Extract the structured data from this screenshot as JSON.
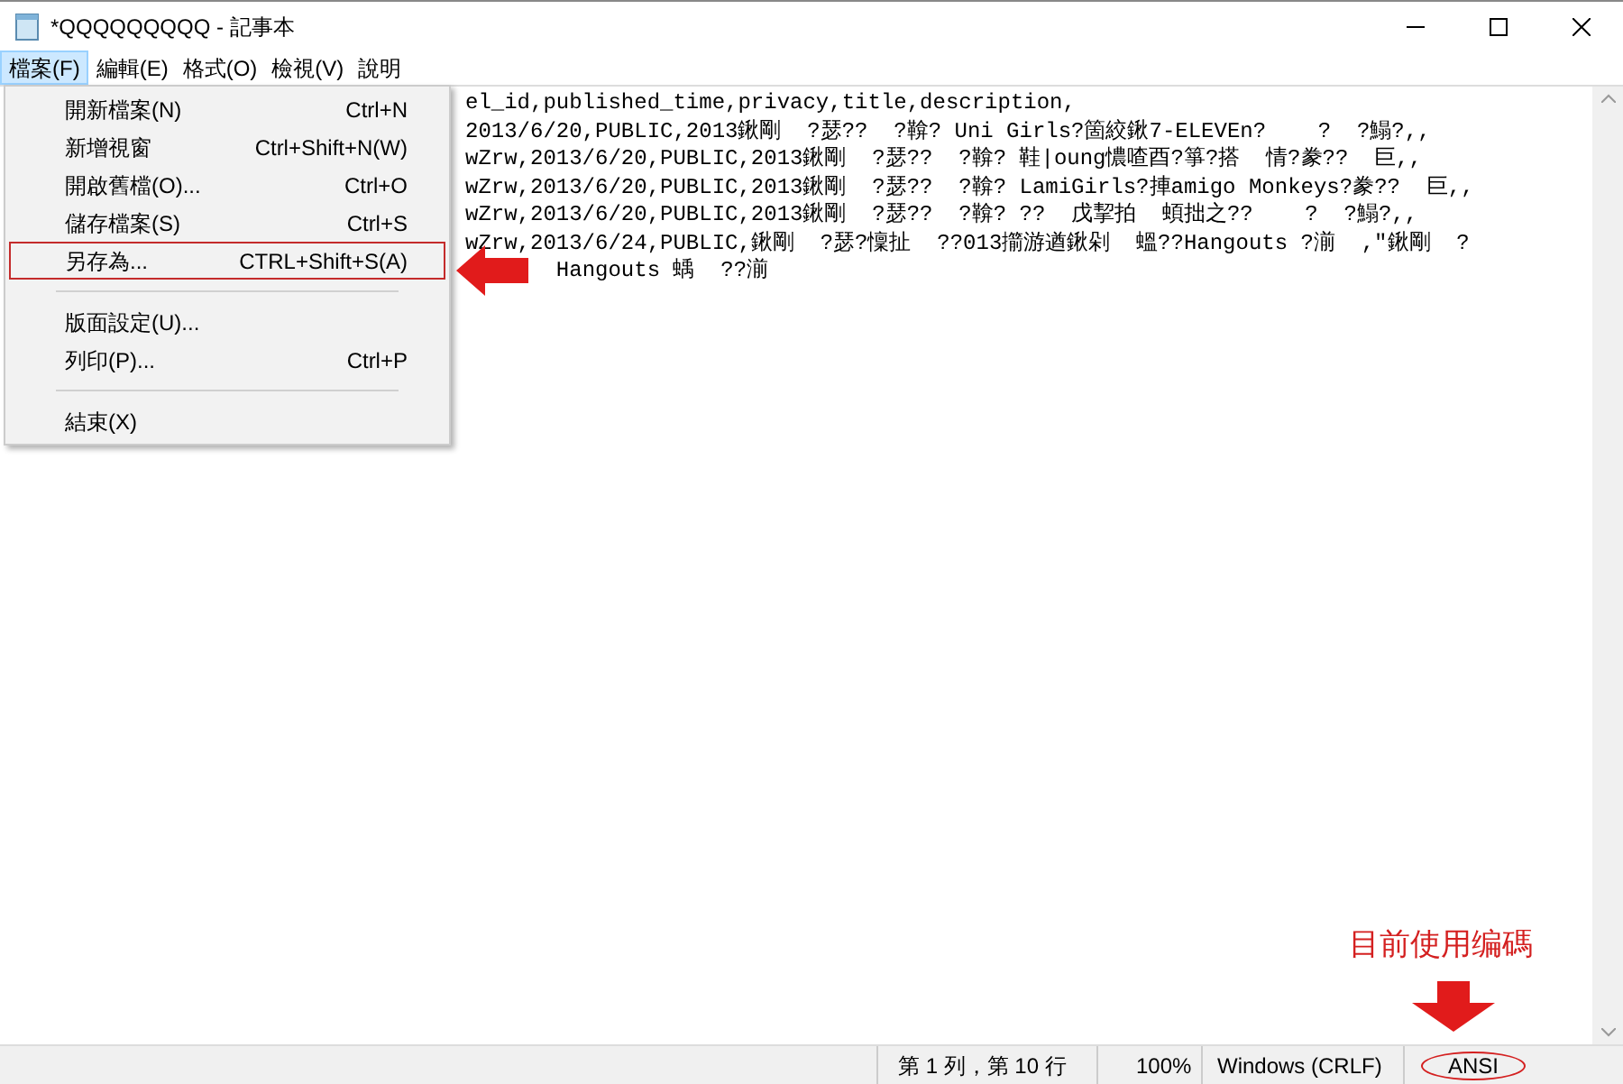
{
  "window": {
    "title": "*QQQQQQQQQ - 記事本"
  },
  "menubar": [
    {
      "label": "檔案(F)",
      "selected": true
    },
    {
      "label": "編輯(E)",
      "selected": false
    },
    {
      "label": "格式(O)",
      "selected": false
    },
    {
      "label": "檢視(V)",
      "selected": false
    },
    {
      "label": "說明",
      "selected": false
    }
  ],
  "editor": {
    "lines": [
      "el_id,published_time,privacy,title,description,",
      "2013/6/20,PUBLIC,2013鍬剛  ?瑟??  ?鞥? Uni Girls?箇絞鍬7-ELEVEn?    ?  ?鰨?,,",
      "wZrw,2013/6/20,PUBLIC,2013鍬剛  ?瑟??  ?鞥? 鞋|oung憹喳酉?箏?搭  情?豢??  巨,,",
      "wZrw,2013/6/20,PUBLIC,2013鍬剛  ?瑟??  ?鞥? LamiGirls?捙amigo Monkeys?豢??  巨,,",
      "wZrw,2013/6/20,PUBLIC,2013鍬剛  ?瑟??  ?鞥? ??  戊挈拍  蝢拙之??    ?  ?鰨?,,",
      "wZrw,2013/6/24,PUBLIC,鍬剛  ?瑟?懍扯  ??013擶游遒鍬剁  蝹??Hangouts ?湔  ,\"鍬剛  ?",
      "       Hangouts 蝺  ??湔"
    ]
  },
  "file_menu": [
    {
      "kind": "item",
      "label": "開新檔案(N)",
      "shortcut": "Ctrl+N",
      "highlighted": false
    },
    {
      "kind": "item",
      "label": "新增視窗",
      "shortcut": "Ctrl+Shift+N(W)",
      "highlighted": false
    },
    {
      "kind": "item",
      "label": "開啟舊檔(O)...",
      "shortcut": "Ctrl+O",
      "highlighted": false
    },
    {
      "kind": "item",
      "label": "儲存檔案(S)",
      "shortcut": "Ctrl+S",
      "highlighted": false
    },
    {
      "kind": "item",
      "label": "另存為...",
      "shortcut": "CTRL+Shift+S(A)",
      "highlighted": true
    },
    {
      "kind": "separator"
    },
    {
      "kind": "item",
      "label": "版面設定(U)...",
      "highlighted": false
    },
    {
      "kind": "item",
      "label": "列印(P)...",
      "shortcut": "Ctrl+P",
      "highlighted": false
    },
    {
      "kind": "separator"
    },
    {
      "kind": "item",
      "label": "結束(X)",
      "highlighted": false
    }
  ],
  "annotation": {
    "label": "目前使用编碼"
  },
  "status_bar": {
    "position": "第 1 列，第 10 行",
    "zoom": "100%",
    "line_ending": "Windows (CRLF)",
    "encoding": "ANSI"
  }
}
